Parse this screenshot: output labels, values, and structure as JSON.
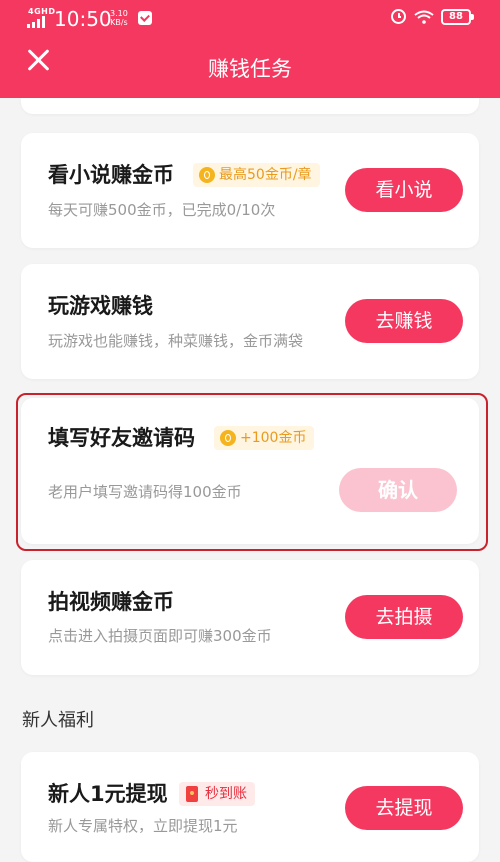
{
  "status_bar": {
    "network": "4GHD",
    "time": "10:50",
    "speed_value": "3.10",
    "speed_unit": "KB/s",
    "battery": "88"
  },
  "header": {
    "title": "赚钱任务"
  },
  "tasks": [
    {
      "title": "看小说赚金币",
      "badge": "最高50金币/章",
      "desc": "每天可赚500金币，已完成0/10次",
      "button": "看小说"
    },
    {
      "title": "玩游戏赚钱",
      "desc": "玩游戏也能赚钱，种菜赚钱，金币满袋",
      "button": "去赚钱"
    },
    {
      "title": "填写好友邀请码",
      "badge": "+100金币",
      "desc": "老用户填写邀请码得100金币",
      "button": "确认"
    },
    {
      "title": "拍视频赚金币",
      "desc": "点击进入拍摄页面即可赚300金币",
      "button": "去拍摄"
    }
  ],
  "section_title": "新人福利",
  "newbie_task": {
    "title": "新人1元提现",
    "badge": "秒到账",
    "desc": "新人专属特权，立即提现1元",
    "button": "去提现"
  },
  "colors": {
    "primary": "#f5385f",
    "disabled_button": "#fbc3cf",
    "coin_badge_text": "#e89b1e",
    "highlight_border": "#c8222d",
    "background": "#f4f4f4"
  },
  "icons": {
    "close": "close-icon",
    "coin": "coin-icon",
    "red_packet": "red-packet-icon"
  }
}
